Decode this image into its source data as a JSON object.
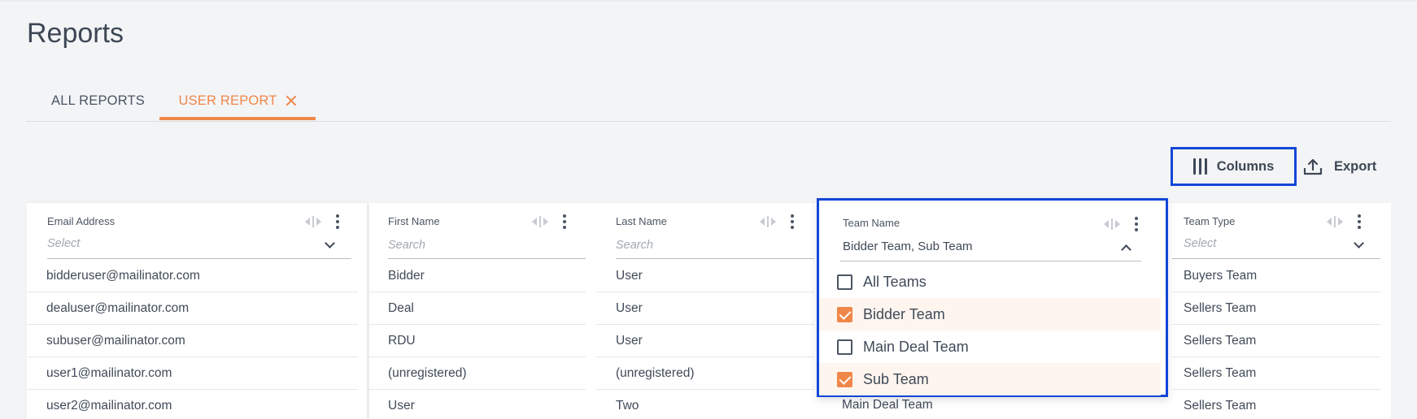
{
  "page": {
    "title": "Reports"
  },
  "tabs": [
    {
      "label": "ALL REPORTS",
      "active": false
    },
    {
      "label": "USER REPORT",
      "active": true,
      "closable": true
    }
  ],
  "toolbar": {
    "columns_label": "Columns",
    "export_label": "Export"
  },
  "colors": {
    "accent": "#f0874a",
    "highlight": "#1247d8",
    "text": "#3f4a58"
  },
  "grid": {
    "columns": [
      {
        "header": "Email Address",
        "filter_placeholder": "Select",
        "filter_type": "select"
      },
      {
        "header": "First Name",
        "filter_placeholder": "Search",
        "filter_type": "search"
      },
      {
        "header": "Last Name",
        "filter_placeholder": "Search",
        "filter_type": "search"
      },
      {
        "header": "Team Name",
        "filter_value": "Bidder Team, Sub Team",
        "filter_type": "select",
        "open": true
      },
      {
        "header": "Team Type",
        "filter_placeholder": "Select",
        "filter_type": "select"
      }
    ],
    "rows": [
      {
        "email": "bidderuser@mailinator.com",
        "first": "Bidder",
        "last": "User",
        "team": "",
        "type": "Buyers Team"
      },
      {
        "email": "dealuser@mailinator.com",
        "first": "Deal",
        "last": "User",
        "team": "",
        "type": "Sellers Team"
      },
      {
        "email": "subuser@mailinator.com",
        "first": "RDU",
        "last": "User",
        "team": "",
        "type": "Sellers Team"
      },
      {
        "email": "user1@mailinator.com",
        "first": "(unregistered)",
        "last": "(unregistered)",
        "team": "",
        "type": "Sellers Team"
      },
      {
        "email": "user2@mailinator.com",
        "first": "User",
        "last": "Two",
        "team": "Main Deal Team",
        "type": "Sellers Team"
      }
    ]
  },
  "team_filter": {
    "options": [
      {
        "label": "All Teams",
        "checked": false
      },
      {
        "label": "Bidder Team",
        "checked": true
      },
      {
        "label": "Main Deal Team",
        "checked": false
      },
      {
        "label": "Sub Team",
        "checked": true
      }
    ]
  },
  "icons": {
    "columns": "columns-icon",
    "export": "upload-icon",
    "close": "close-icon",
    "resize": "column-resize-icon",
    "menu": "kebab-menu-icon",
    "expand": "chevron-down-icon",
    "collapse": "chevron-up-icon",
    "checkbox": "checkbox-icon"
  }
}
